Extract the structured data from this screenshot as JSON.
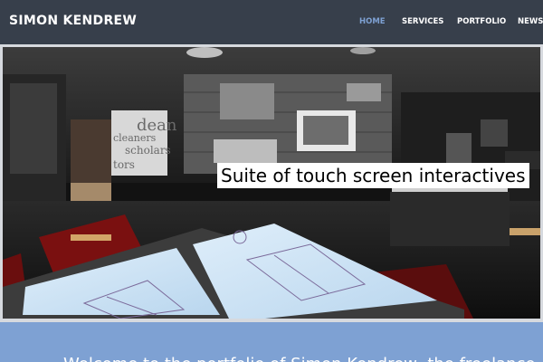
{
  "header": {
    "brand": "SIMON KENDREW",
    "nav": [
      {
        "label": "HOME",
        "active": true
      },
      {
        "label": "SERVICES",
        "active": false
      },
      {
        "label": "PORTFOLIO",
        "active": false
      },
      {
        "label": "NEWS",
        "active": false
      }
    ]
  },
  "hero": {
    "caption": "Suite of touch screen interactives",
    "wall_text": [
      "dean",
      "cleaners",
      "scholars",
      "tors"
    ]
  },
  "welcome": {
    "text": "Welcome to the portfolio of Simon Kendrew, the freelance"
  },
  "colors": {
    "header_bg": "#373f4b",
    "nav_active": "#7ea1d3",
    "band_bg": "#7ea1d3"
  }
}
